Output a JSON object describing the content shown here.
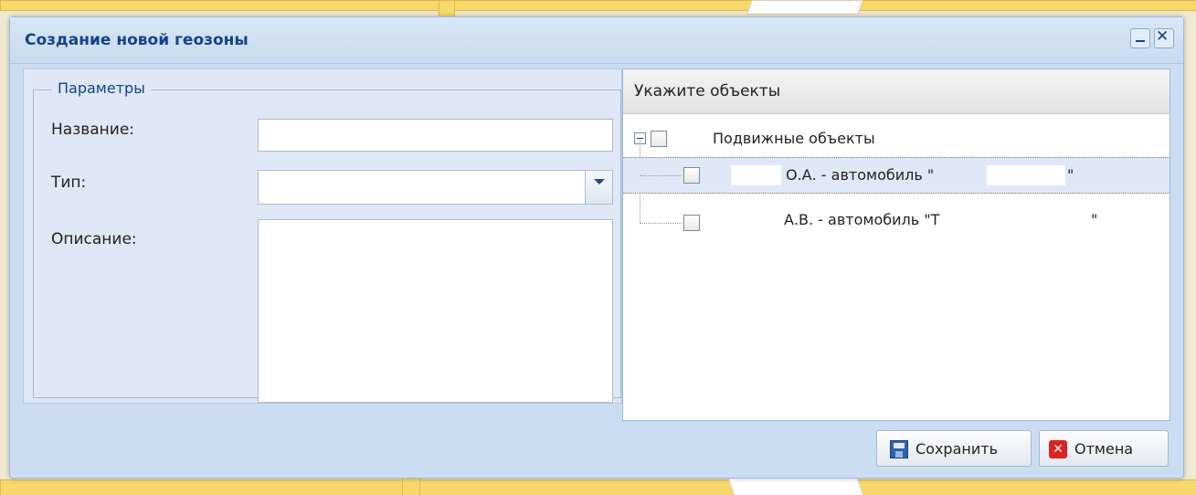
{
  "window": {
    "title": "Создание новой геозоны",
    "minimize_icon": "minimize-icon",
    "close_icon": "close-icon"
  },
  "parameters": {
    "legend": "Параметры",
    "name_label": "Название:",
    "name_value": "",
    "type_label": "Тип:",
    "type_value": "",
    "description_label": "Описание:",
    "description_value": ""
  },
  "objects": {
    "header": "Укажите объекты",
    "root": {
      "label": "Подвижные объекты",
      "checked": false,
      "expanded": true
    },
    "children": [
      {
        "label": "О.А. - автомобиль \"",
        "suffix": "\"",
        "checked": false,
        "selected": true
      },
      {
        "label": "А.В. - автомобиль \"Т",
        "suffix": "\"",
        "checked": false,
        "selected": false
      }
    ]
  },
  "footer": {
    "save_label": "Сохранить",
    "cancel_label": "Отмена",
    "save_icon": "floppy-disk-icon",
    "cancel_icon": "cross-icon"
  },
  "colors": {
    "header_title": "#15428b",
    "window_border": "#99bbe8",
    "panel_bg": "#dfe8f6",
    "cancel_red": "#dd2222"
  }
}
